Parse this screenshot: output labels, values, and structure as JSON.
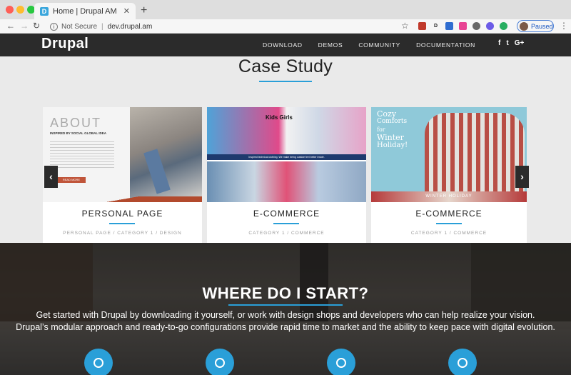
{
  "browser": {
    "tab_title": "Home | Drupal AM",
    "tab_favicon": "D",
    "new_tab": "+",
    "security": "Not Secure",
    "url": "dev.drupal.am",
    "profile_status": "Paused"
  },
  "site": {
    "logo": "Drupal",
    "menu": [
      "DOWNLOAD",
      "DEMOS",
      "COMMUNITY",
      "DOCUMENTATION"
    ],
    "social": [
      "f",
      "t",
      "G+"
    ]
  },
  "case_study": {
    "title": "Case Study",
    "cards": [
      {
        "label": "PERSONAL PAGE",
        "meta": "PERSONAL PAGE / CATEGORY 1 / DESIGN"
      },
      {
        "label": "E-COMMERCE",
        "meta": "CATEGORY 1 / COMMERCE"
      },
      {
        "label": "E-COMMERCE",
        "meta": "CATEGORY 1 / COMMERCE"
      }
    ],
    "card1_image": {
      "heading": "ABOUT",
      "sub": "INSPIRED BY SOCIAL GLOBAL IDEA",
      "button": "READ MORE"
    },
    "card2_image": {
      "heading": "Kids Girls",
      "sub": "Inspired technical clothing. We make being outside feel better inside."
    },
    "card3_image": {
      "line1": "Cozy",
      "line2": "Comforts",
      "line3": "for",
      "line4": "Winter",
      "line5": "Holiday!",
      "footer": "WINTER HOLIDAY"
    }
  },
  "where": {
    "title": "WHERE DO I START?",
    "line1": "Get started with Drupal by downloading it yourself, or work with design shops and developers who can help realize your vision.",
    "line2": "Drupal’s modular approach and ready-to-go configurations provide rapid time to market and the ability to keep pace with digital evolution."
  },
  "colors": {
    "accent": "#2a9fd8",
    "nav_bg": "#2b2b2b",
    "page_bg": "#eaeaea"
  },
  "icons": [
    "info-icon",
    "back-icon",
    "forward-icon",
    "reload-icon",
    "star-icon",
    "kebab-icon",
    "facebook-icon",
    "twitter-icon",
    "google-plus-icon",
    "chevron-left-icon",
    "chevron-right-icon"
  ]
}
